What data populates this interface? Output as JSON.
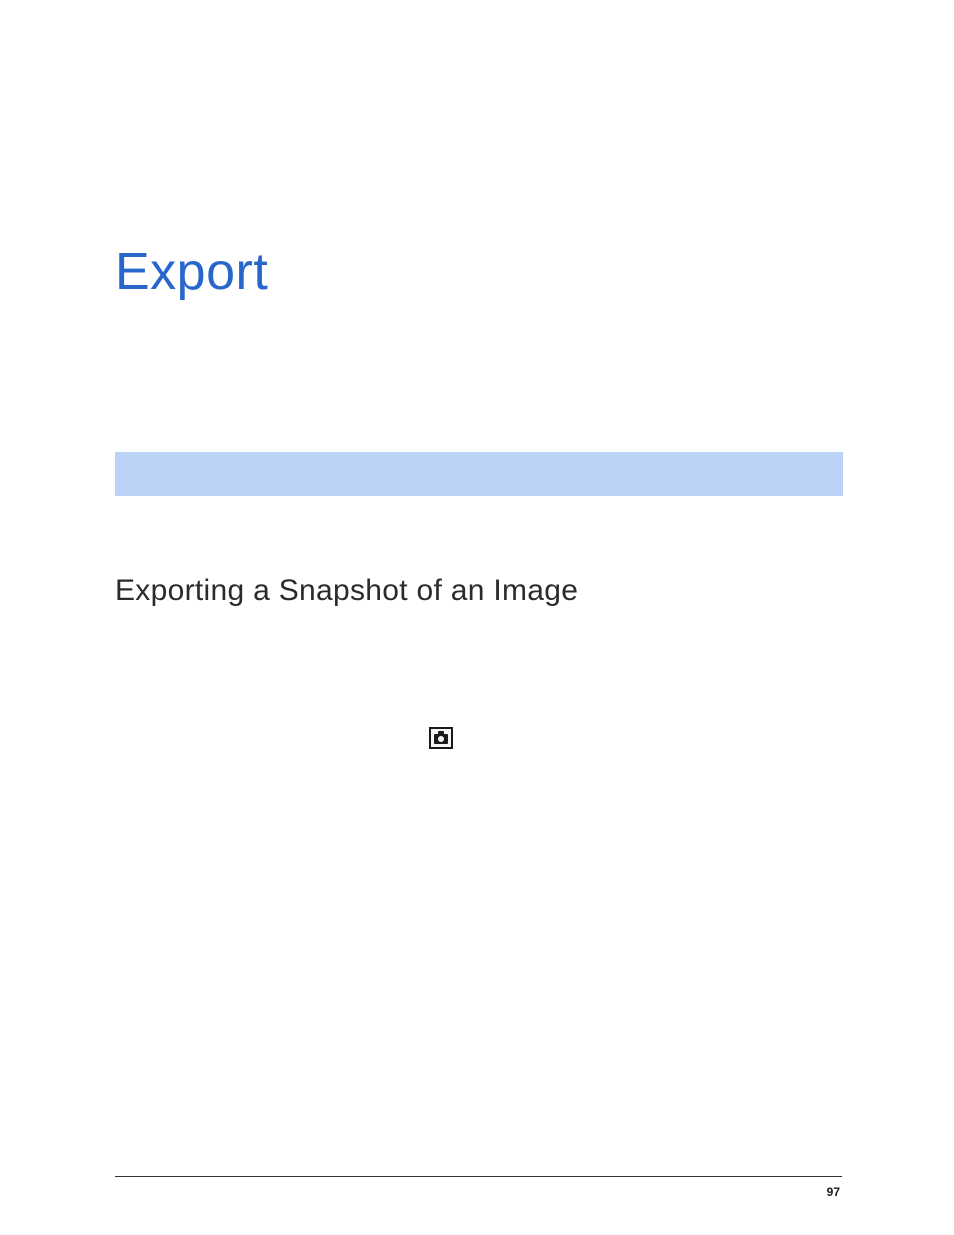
{
  "chapter": {
    "title": "Export"
  },
  "section": {
    "heading": "Exporting a Snapshot of an Image"
  },
  "footer": {
    "pageNumber": "97"
  },
  "icons": {
    "snapshot": "snapshot-camera-icon"
  }
}
